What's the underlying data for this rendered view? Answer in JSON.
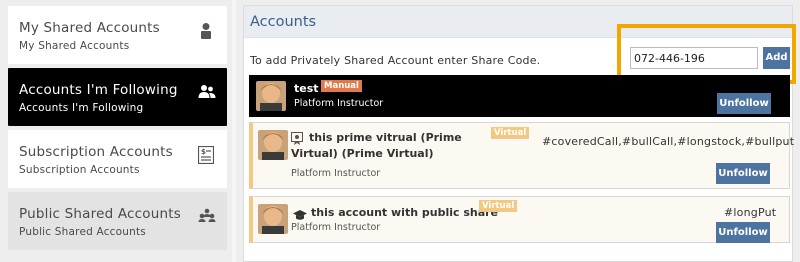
{
  "sidebar": {
    "items": [
      {
        "title": "My Shared Accounts",
        "subtitle": "My Shared Accounts",
        "icon": "person-icon"
      },
      {
        "title": "Accounts I'm Following",
        "subtitle": "Accounts I'm Following",
        "icon": "users-icon"
      },
      {
        "title": "Subscription Accounts",
        "subtitle": "Subscription Accounts",
        "icon": "dollar-list-icon"
      },
      {
        "title": "Public Shared Accounts",
        "subtitle": "Public Shared Accounts",
        "icon": "group-icon"
      }
    ]
  },
  "main": {
    "title": "Accounts",
    "share_text": "To add Privately Shared Account enter Share Code.",
    "share_code": "072-446-196",
    "add_label": "Add",
    "cards": [
      {
        "name": "test",
        "role": "Platform Instructor",
        "badge": "Manual",
        "tags": "",
        "button": "Unfollow"
      },
      {
        "name": "this prime vitrual (Prime Virtual) (Prime Virtual)",
        "name_line1": "this prime vitrual (Prime",
        "name_line2": "Virtual) (Prime Virtual)",
        "role": "Platform Instructor",
        "badge": "Virtual",
        "tags": "#coveredCall,#bullCall,#longstock,#bullput",
        "button": "Unfollow"
      },
      {
        "name": "this account with public share",
        "role": "Platform Instructor",
        "badge": "Virtual",
        "tags": "#longPut",
        "button": "Unfollow"
      }
    ]
  },
  "colors": {
    "accent": "#4d74a0",
    "highlight": "#f0a800",
    "manual_badge": "#e07a4c",
    "virtual_badge": "#f3c882",
    "active_nav": "#000000"
  }
}
